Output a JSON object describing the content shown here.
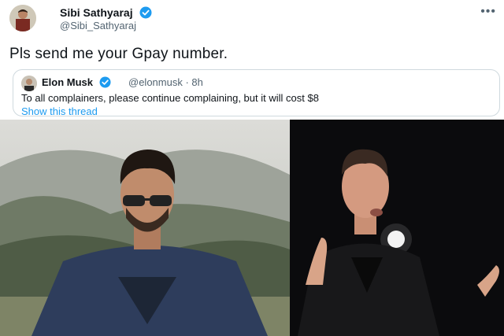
{
  "tweet": {
    "display_name": "Sibi Sathyaraj",
    "handle": "@Sibi_Sathyaraj",
    "more_icon": "ellipsis-icon",
    "text": "Pls send me your Gpay number.",
    "verified_icon": "verified-badge-icon"
  },
  "quote": {
    "display_name": "Elon Musk",
    "handle_time": "@elonmusk · 8h",
    "text": "To all complainers, please continue complaining, but it will cost $8",
    "thread_link": "Show this thread"
  },
  "colors": {
    "accent": "#1d9bf0",
    "secondary_text": "#536471",
    "border": "#cfd9de"
  }
}
